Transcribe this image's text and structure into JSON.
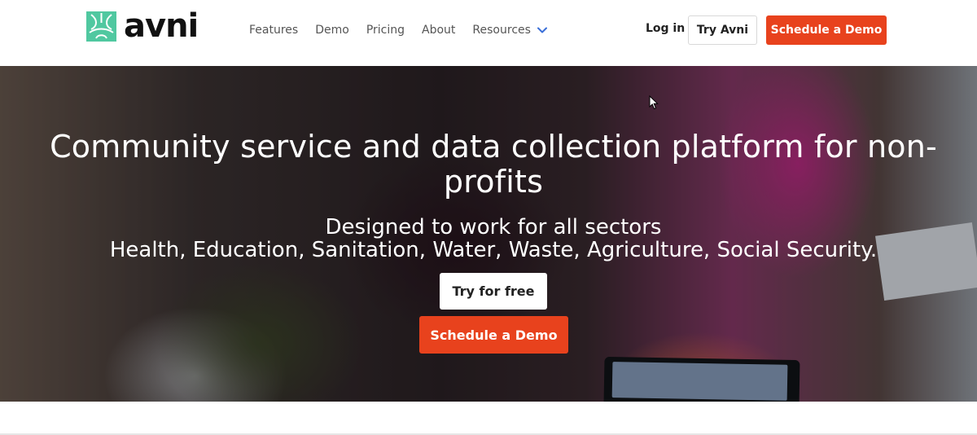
{
  "brand": {
    "name": "avni",
    "color": "#50c8a0",
    "accent": "#e8421d"
  },
  "nav": {
    "items": [
      {
        "label": "Features"
      },
      {
        "label": "Demo"
      },
      {
        "label": "Pricing"
      },
      {
        "label": "About"
      },
      {
        "label": "Resources"
      }
    ],
    "resources_icon": "chevron-down-icon"
  },
  "header": {
    "login_label": "Log in",
    "try_label": "Try Avni",
    "schedule_label": "Schedule a Demo"
  },
  "hero": {
    "headline": "Community service and data collection platform for non-profits",
    "subheading_line1": "Designed to work for all sectors",
    "subheading_line2": "Health, Education, Sanitation, Water, Waste, Agriculture, Social Security.",
    "try_free_label": "Try for free",
    "schedule_label": "Schedule a Demo"
  }
}
